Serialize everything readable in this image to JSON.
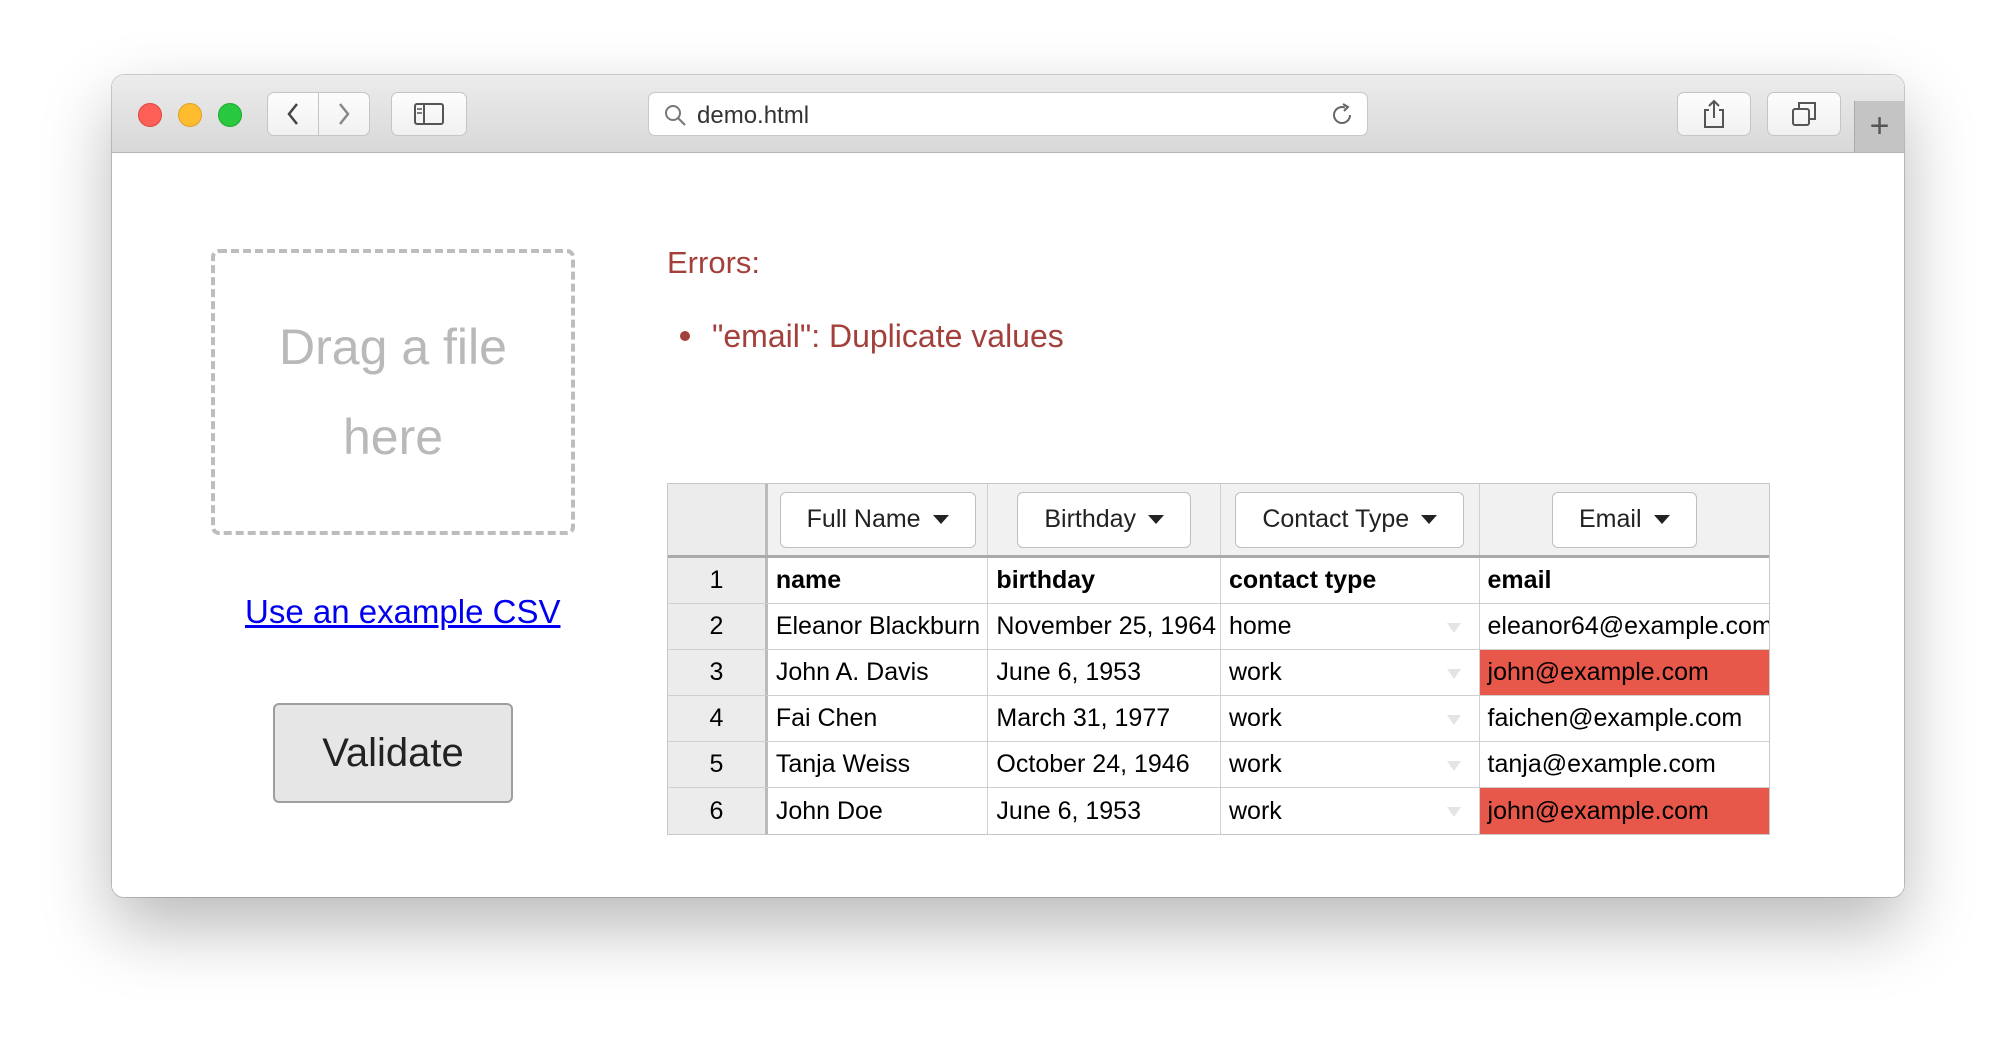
{
  "browser": {
    "url": "demo.html"
  },
  "dropzone": {
    "text": "Drag a file here"
  },
  "example_link": "Use an example CSV",
  "validate_label": "Validate",
  "errors": {
    "title": "Errors:",
    "items": [
      "\"email\": Duplicate values"
    ]
  },
  "table": {
    "columns": [
      "Full Name",
      "Birthday",
      "Contact Type",
      "Email"
    ],
    "rows": [
      {
        "n": "1",
        "name": "name",
        "birthday": "birthday",
        "type": "contact type",
        "email": "email"
      },
      {
        "n": "2",
        "name": "Eleanor Blackburn",
        "birthday": "November 25, 1964",
        "type": "home",
        "email": "eleanor64@example.com"
      },
      {
        "n": "3",
        "name": "John A. Davis",
        "birthday": "June 6, 1953",
        "type": "work",
        "email": "john@example.com"
      },
      {
        "n": "4",
        "name": "Fai Chen",
        "birthday": "March 31, 1977",
        "type": "work",
        "email": "faichen@example.com"
      },
      {
        "n": "5",
        "name": "Tanja Weiss",
        "birthday": "October 24, 1946",
        "type": "work",
        "email": "tanja@example.com"
      },
      {
        "n": "6",
        "name": "John Doe",
        "birthday": "June 6, 1953",
        "type": "work",
        "email": "john@example.com"
      }
    ],
    "error_color": "#e8584a"
  }
}
